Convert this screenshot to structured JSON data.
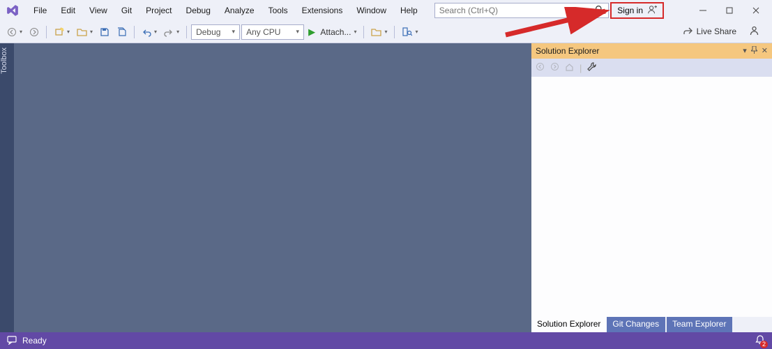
{
  "menu": {
    "items": [
      "File",
      "Edit",
      "View",
      "Git",
      "Project",
      "Debug",
      "Analyze",
      "Tools",
      "Extensions",
      "Window",
      "Help"
    ]
  },
  "search": {
    "placeholder": "Search (Ctrl+Q)"
  },
  "signin": {
    "label": "Sign in"
  },
  "toolbar": {
    "config_combo": "Debug",
    "platform_combo": "Any CPU",
    "attach_label": "Attach..."
  },
  "liveshare": {
    "label": "Live Share"
  },
  "sidebar": {
    "toolbox_label": "Toolbox"
  },
  "panel": {
    "title": "Solution Explorer",
    "tabs": [
      "Solution Explorer",
      "Git Changes",
      "Team Explorer"
    ]
  },
  "status": {
    "ready": "Ready",
    "notification_count": "2"
  }
}
